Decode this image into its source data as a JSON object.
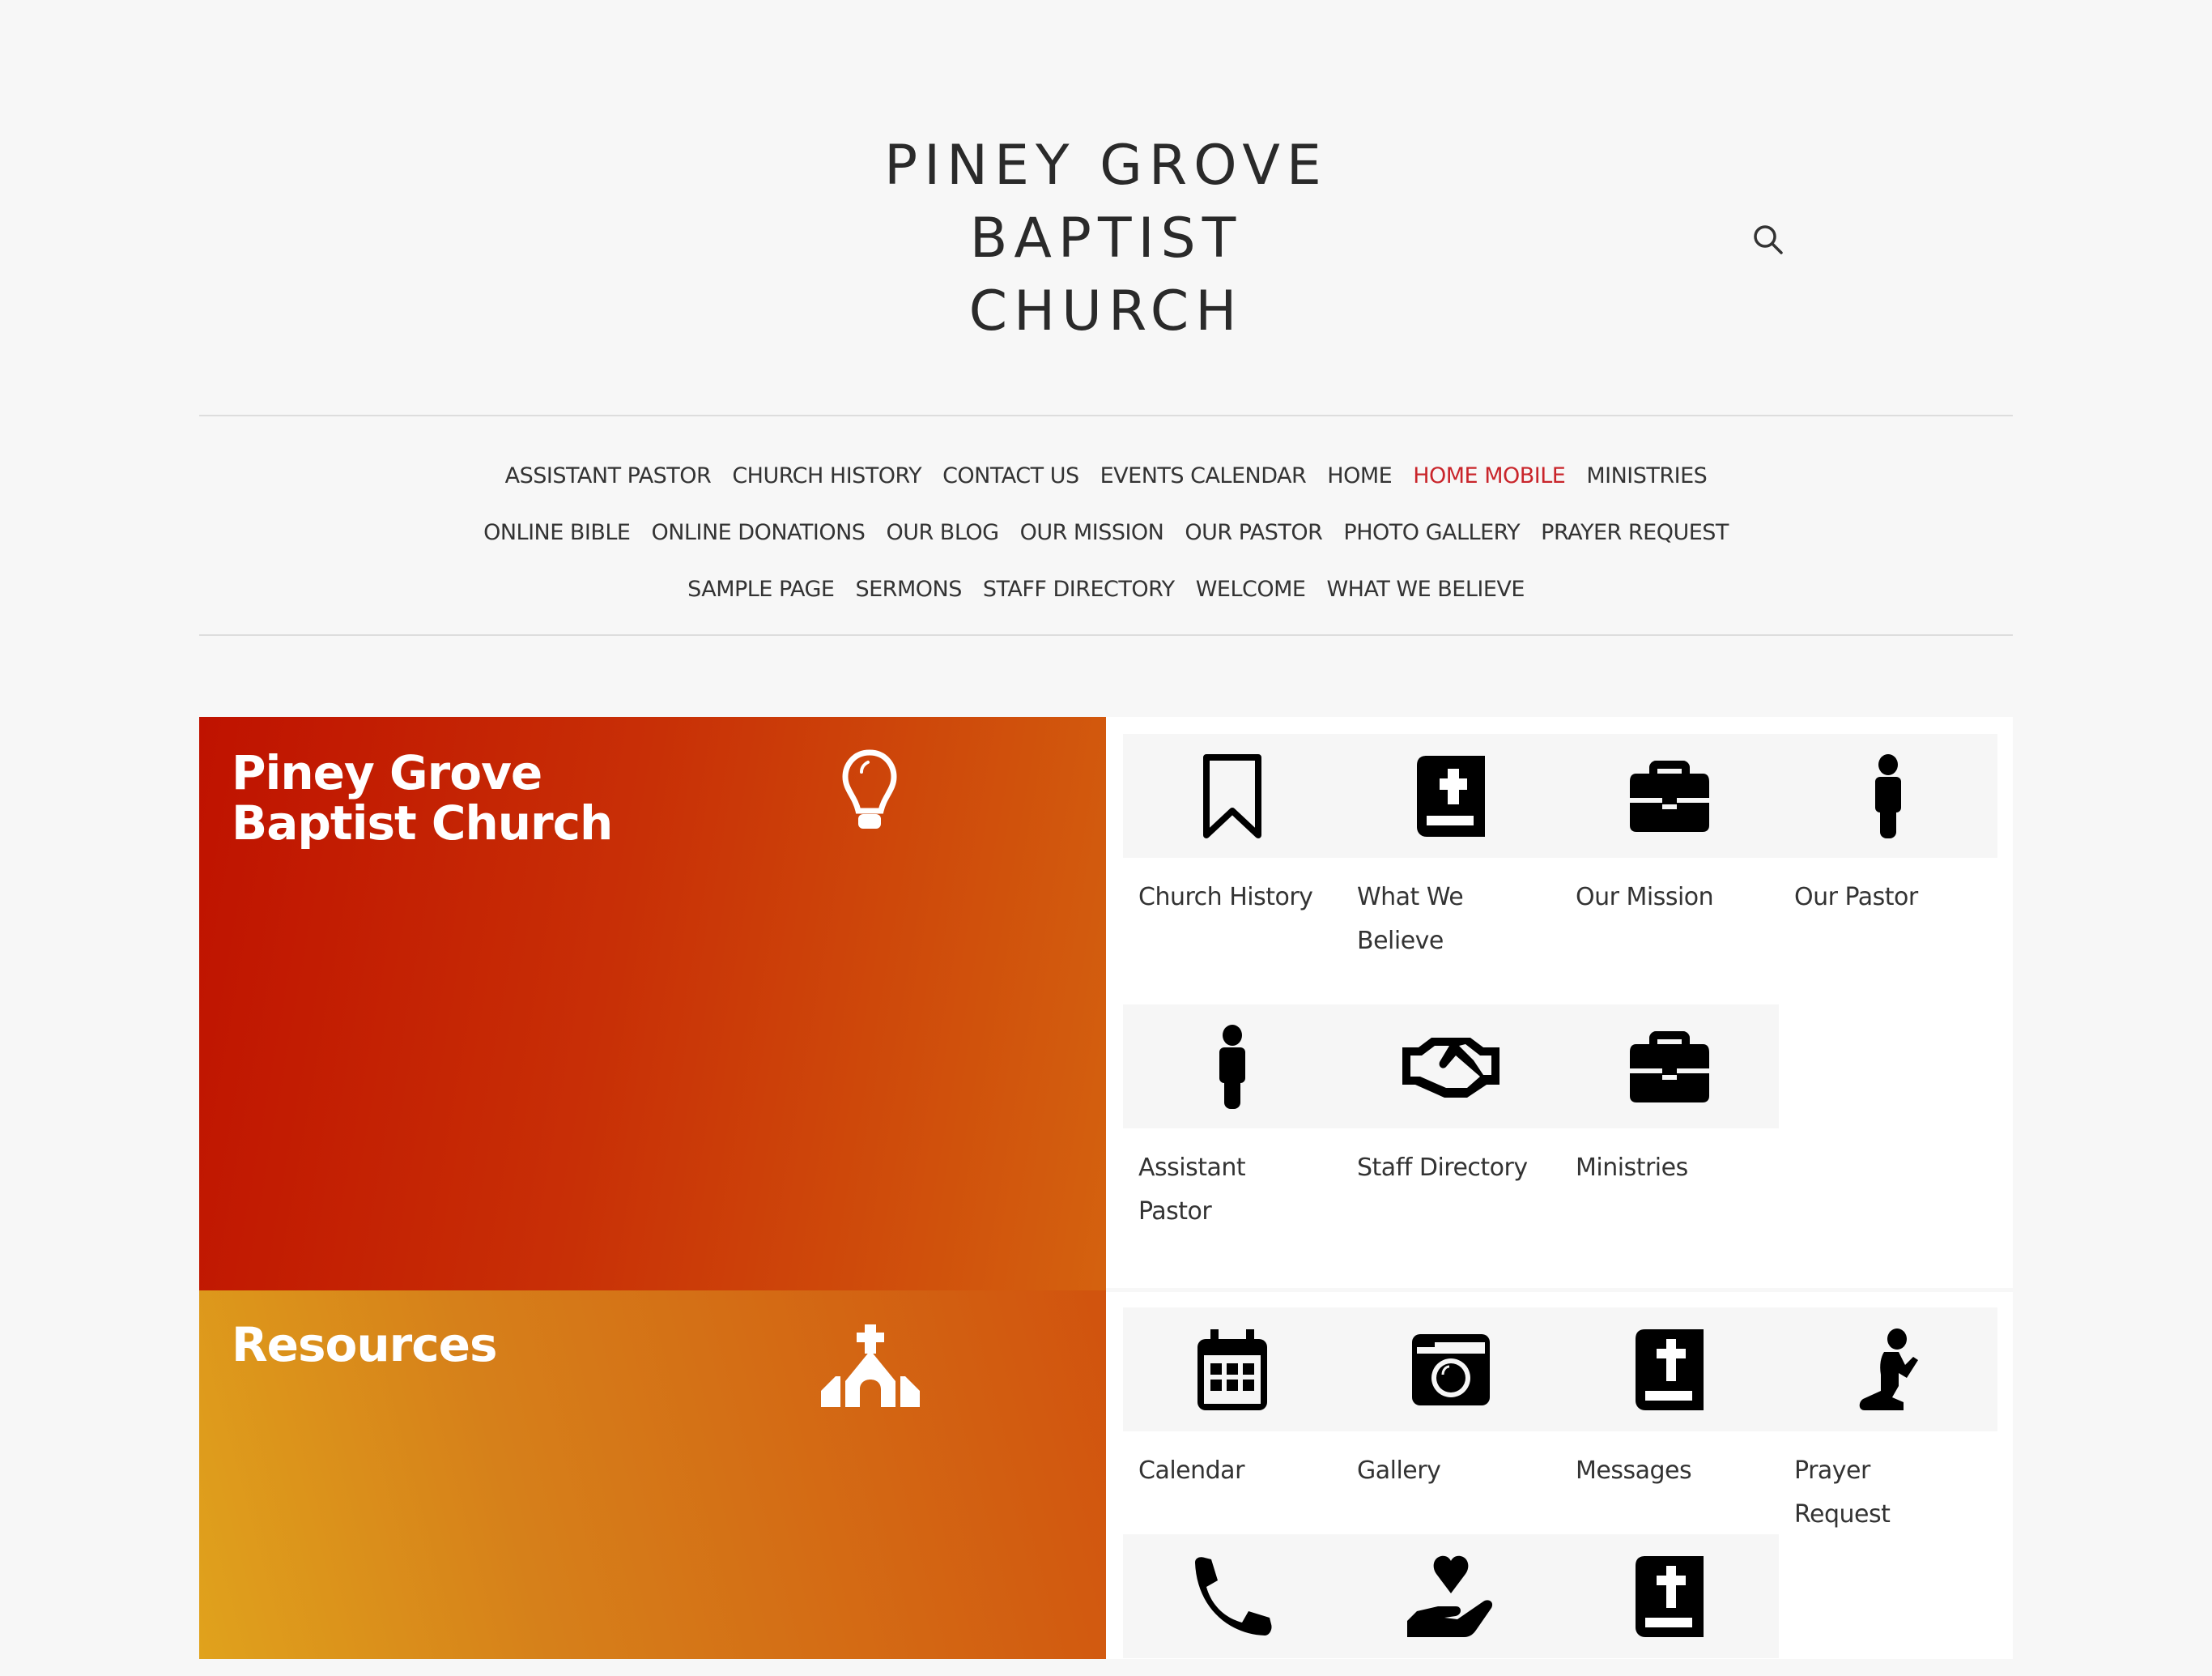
{
  "site": {
    "title_lines": [
      "PINEY GROVE",
      "BAPTIST",
      "CHURCH"
    ],
    "search_icon": "search-icon"
  },
  "colors": {
    "background": "#f7f7f7",
    "nav_active": "#c9252b",
    "panel_red": "#c82f06",
    "panel_orange": "#d6801a",
    "tile_band": "#f6f6f6"
  },
  "nav": {
    "rows": [
      [
        {
          "label": "ASSISTANT PASTOR",
          "active": false
        },
        {
          "label": "CHURCH HISTORY",
          "active": false
        },
        {
          "label": "CONTACT US",
          "active": false
        },
        {
          "label": "EVENTS CALENDAR",
          "active": false
        },
        {
          "label": "HOME",
          "active": false
        },
        {
          "label": "HOME MOBILE",
          "active": true
        },
        {
          "label": "MINISTRIES",
          "active": false
        }
      ],
      [
        {
          "label": "ONLINE BIBLE",
          "active": false
        },
        {
          "label": "ONLINE DONATIONS",
          "active": false
        },
        {
          "label": "OUR BLOG",
          "active": false
        },
        {
          "label": "OUR MISSION",
          "active": false
        },
        {
          "label": "OUR PASTOR",
          "active": false
        },
        {
          "label": "PHOTO GALLERY",
          "active": false
        },
        {
          "label": "PRAYER REQUEST",
          "active": false
        }
      ],
      [
        {
          "label": "SAMPLE PAGE",
          "active": false
        },
        {
          "label": "SERMONS",
          "active": false
        },
        {
          "label": "STAFF DIRECTORY",
          "active": false
        },
        {
          "label": "WELCOME",
          "active": false
        },
        {
          "label": "WHAT WE BELIEVE",
          "active": false
        }
      ]
    ]
  },
  "sections": [
    {
      "title_lines": [
        "Piney Grove",
        "Baptist Church"
      ],
      "icon": "lightbulb-icon",
      "tiles": [
        {
          "label": "Church History",
          "icon": "bookmark-icon"
        },
        {
          "label": "What We Believe",
          "icon": "bible-icon"
        },
        {
          "label": "Our Mission",
          "icon": "briefcase-icon"
        },
        {
          "label": "Our Pastor",
          "icon": "person-icon"
        },
        {
          "label": "Assistant Pastor",
          "icon": "person-icon"
        },
        {
          "label": "Staff Directory",
          "icon": "handshake-icon"
        },
        {
          "label": "Ministries",
          "icon": "briefcase-icon"
        }
      ]
    },
    {
      "title_lines": [
        "Resources"
      ],
      "icon": "church-icon",
      "tiles": [
        {
          "label": "Calendar",
          "icon": "calendar-icon"
        },
        {
          "label": "Gallery",
          "icon": "camera-icon"
        },
        {
          "label": "Messages",
          "icon": "bible-icon"
        },
        {
          "label": "Prayer Request",
          "icon": "praying-person-icon"
        },
        {
          "label": "",
          "icon": "phone-icon"
        },
        {
          "label": "",
          "icon": "hand-holding-heart-icon"
        },
        {
          "label": "",
          "icon": "bible-icon"
        }
      ]
    }
  ]
}
